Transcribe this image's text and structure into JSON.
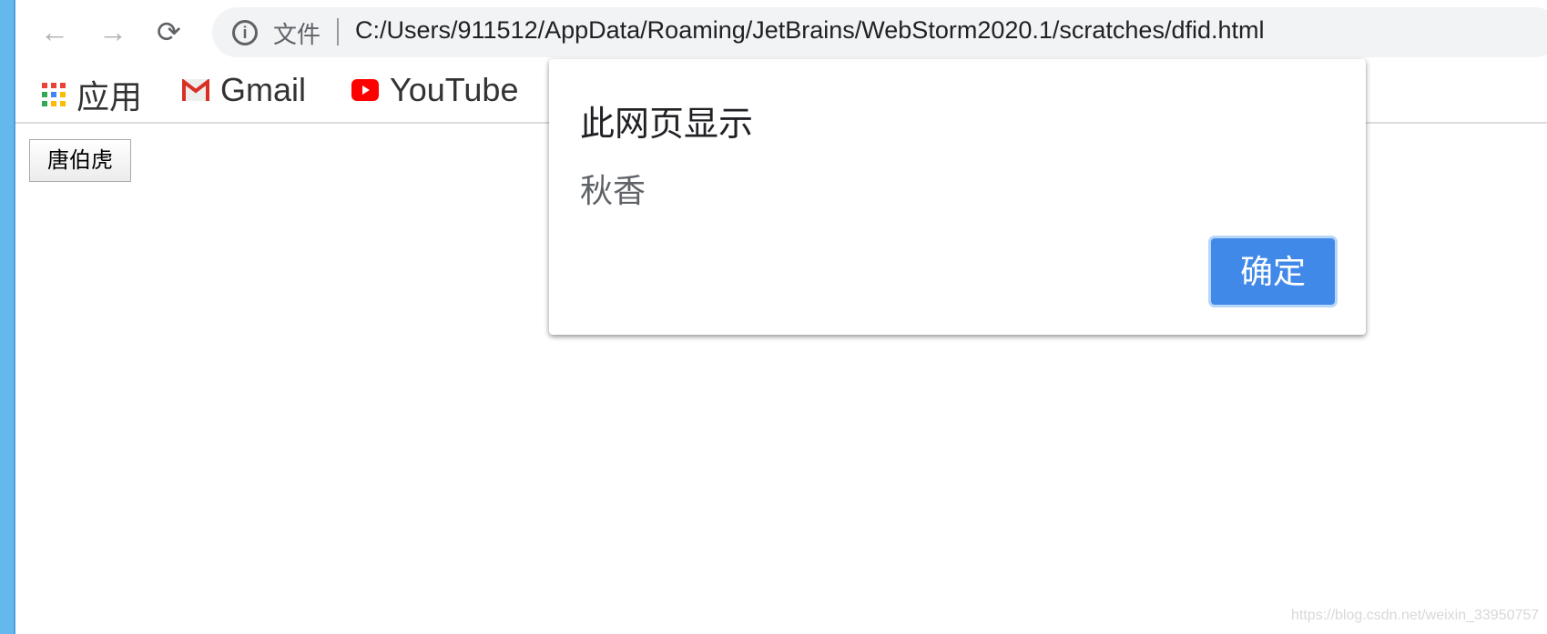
{
  "browser": {
    "address_prefix": "文件",
    "url": "C:/Users/911512/AppData/Roaming/JetBrains/WebStorm2020.1/scratches/dfid.html",
    "bookmarks": [
      {
        "label": "应用",
        "icon": "apps-grid-icon"
      },
      {
        "label": "Gmail",
        "icon": "gmail-icon"
      },
      {
        "label": "YouTube",
        "icon": "youtube-icon"
      }
    ]
  },
  "page": {
    "button_label": "唐伯虎"
  },
  "alert": {
    "title": "此网页显示",
    "message": "秋香",
    "ok_label": "确定",
    "accent": "#4189e8"
  },
  "watermark": "https://blog.csdn.net/weixin_33950757"
}
